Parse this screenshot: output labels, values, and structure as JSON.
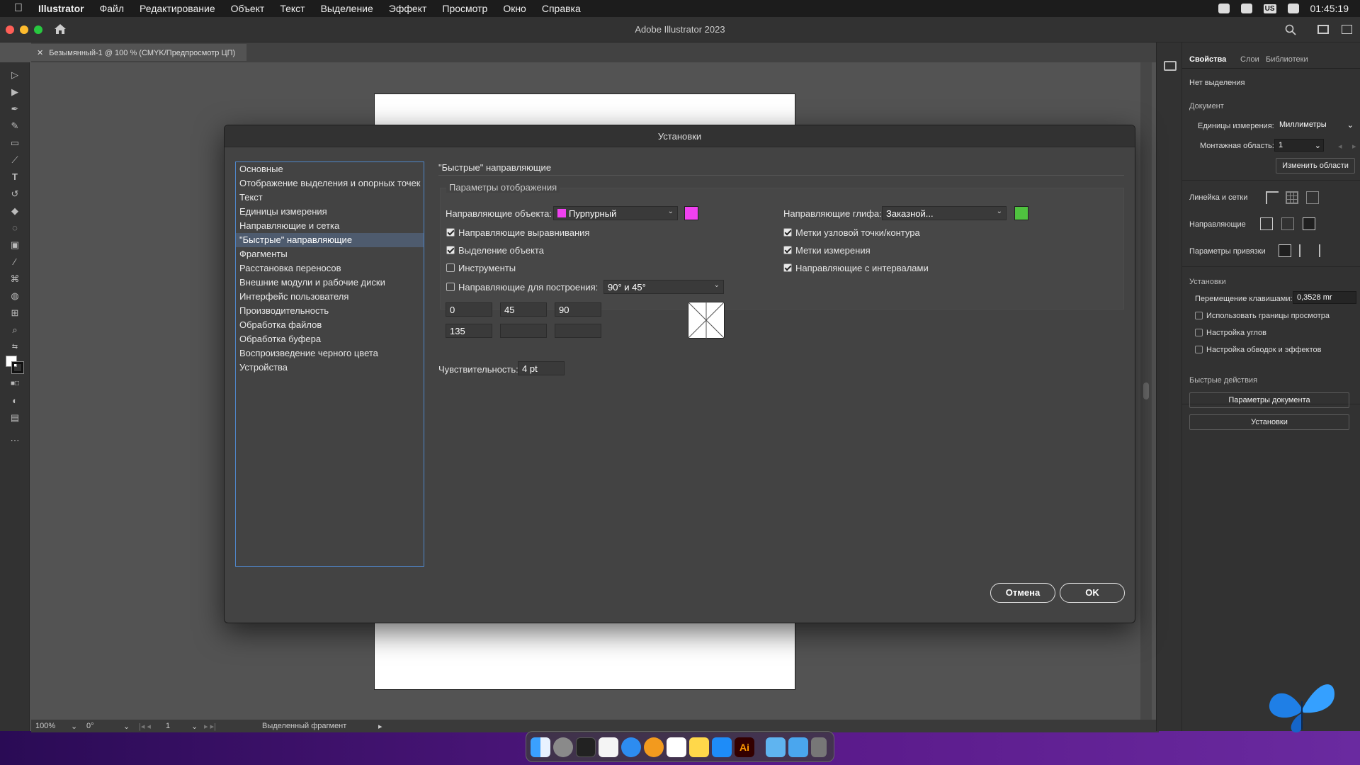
{
  "menubar": {
    "apple": "",
    "app": "Illustrator",
    "items": [
      "Файл",
      "Редактирование",
      "Объект",
      "Текст",
      "Выделение",
      "Эффект",
      "Просмотр",
      "Окно",
      "Справка"
    ],
    "kb_layout": "US",
    "clock": "01:45:19"
  },
  "window": {
    "title": "Adobe Illustrator 2023"
  },
  "doc_tab": {
    "label": "Безымянный-1 @ 100 % (CMYK/Предпросмотр ЦП)"
  },
  "status": {
    "zoom": "100%",
    "rotation": "0°",
    "artboard": "1",
    "info": "Выделенный фрагмент"
  },
  "props": {
    "tabs": [
      "Свойства",
      "Слои",
      "Библиотеки"
    ],
    "no_selection": "Нет выделения",
    "document": "Документ",
    "units_label": "Единицы измерения:",
    "units_value": "Миллиметры",
    "artboard_label": "Монтажная область:",
    "artboard_value": "1",
    "edit_artboards": "Изменить области",
    "rulers_grids": "Линейка и сетки",
    "guides": "Направляющие",
    "snap": "Параметры привязки",
    "prefs": "Установки",
    "keyboard_inc_label": "Перемещение клавишами:",
    "keyboard_inc_value": "0,3528 mr",
    "chk_preview_bounds": "Использовать границы просмотра",
    "chk_scale_corners": "Настройка углов",
    "chk_scale_strokes": "Настройка обводок и эффектов",
    "quick_actions": "Быстрые действия",
    "doc_setup": "Параметры документа",
    "prefs_btn": "Установки"
  },
  "dialog": {
    "title": "Установки",
    "categories": [
      "Основные",
      "Отображение выделения и опорных точек",
      "Текст",
      "Единицы измерения",
      "Направляющие и сетка",
      "\"Быстрые\" направляющие",
      "Фрагменты",
      "Расстановка переносов",
      "Внешние модули и рабочие диски",
      "Интерфейс пользователя",
      "Производительность",
      "Обработка файлов",
      "Обработка буфера",
      "Воспроизведение черного цвета",
      "Устройства"
    ],
    "selected_index": 5,
    "section_title": "\"Быстрые\" направляющие",
    "group_title": "Параметры отображения",
    "object_guides_label": "Направляющие объекта:",
    "object_guides_value": "Пурпурный",
    "object_color": "#f041f0",
    "glyph_guides_label": "Направляющие глифа:",
    "glyph_guides_value": "Заказной...",
    "glyph_color": "#4fc23f",
    "left_checks": [
      {
        "label": "Направляющие выравнивания",
        "checked": true
      },
      {
        "label": "Выделение объекта",
        "checked": true
      },
      {
        "label": "Инструменты",
        "checked": false
      },
      {
        "label": "Направляющие для построения:",
        "checked": false
      }
    ],
    "right_checks": [
      {
        "label": "Метки узловой точки/контура",
        "checked": true
      },
      {
        "label": "Метки измерения",
        "checked": true
      },
      {
        "label": "Направляющие с интервалами",
        "checked": true
      }
    ],
    "construction_value": "90° и 45°",
    "angles": [
      "0",
      "45",
      "90",
      "135",
      "",
      ""
    ],
    "tolerance_label": "Чувствительность:",
    "tolerance_value": "4 pt",
    "cancel": "Отмена",
    "ok": "OK"
  }
}
